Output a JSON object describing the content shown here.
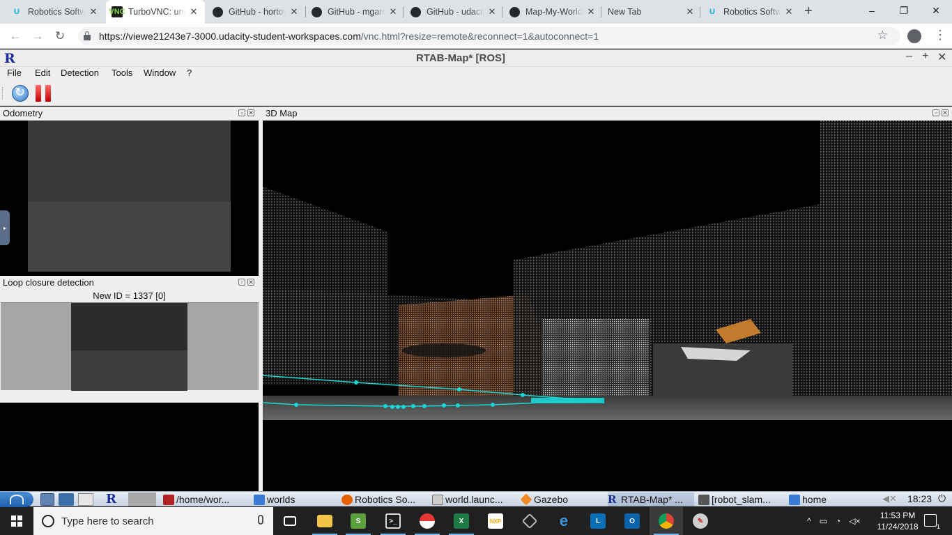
{
  "browser": {
    "tabs": [
      {
        "title": "Robotics Software",
        "icon": "udacity-icon"
      },
      {
        "title": "TurboVNC: unix",
        "icon": "turbovnc-icon",
        "active": true
      },
      {
        "title": "GitHub - hortovanyi",
        "icon": "github-icon"
      },
      {
        "title": "GitHub - mgarcia",
        "icon": "github-icon"
      },
      {
        "title": "GitHub - udacity",
        "icon": "github-icon"
      },
      {
        "title": "Map-My-World",
        "icon": "github-icon"
      },
      {
        "title": "New Tab",
        "icon": ""
      },
      {
        "title": "Robotics Software",
        "icon": "udacity-icon"
      }
    ],
    "new_tab": "+",
    "url_host": "https://viewe21243e7-3000.udacity-student-workspaces.com",
    "url_path": "/vnc.html?resize=remote&reconnect=1&autoconnect=1",
    "window_controls": {
      "minimize": "–",
      "restore": "❐",
      "close": "✕"
    }
  },
  "rtabmap": {
    "logo": "R",
    "title": "RTAB-Map* [ROS]",
    "window_buttons": [
      "–",
      "+",
      "✕"
    ],
    "menus": [
      "File",
      "Edit",
      "Detection",
      "Tools",
      "Window",
      "?"
    ],
    "odometry_label": "Odometry",
    "map_label": "3D Map",
    "loop_label": "Loop closure detection",
    "new_id": "New ID = 1337 [0]",
    "dock_float": "▫",
    "dock_close": "✕",
    "trajectory_color": "#19d6d6"
  },
  "vnc_panel": {
    "tasks": [
      {
        "label": "/home/wor...",
        "color": "#b22222"
      },
      {
        "label": "worlds",
        "color": "#3a7bd5"
      },
      {
        "label": "Robotics So...",
        "color": "#e66000"
      },
      {
        "label": "world.launc...",
        "color": "#cccccc"
      },
      {
        "label": "Gazebo",
        "color": "#f08a24"
      },
      {
        "label": "RTAB-Map* ...",
        "color": "#1b2f9a"
      },
      {
        "label": "[robot_slam...",
        "color": "#555555"
      },
      {
        "label": "home",
        "color": "#3a7bd5"
      }
    ],
    "clock": "18:23"
  },
  "windows": {
    "search_placeholder": "Type here to search",
    "time": "11:53 PM",
    "date": "11/24/2018",
    "apps": [
      "task-view",
      "file-explorer",
      "sublime-text",
      "terminal-app",
      "pokeball-app",
      "excel",
      "nxp-app",
      "3d-viewer",
      "edge",
      "lync",
      "outlook",
      "chrome",
      "paint-app"
    ]
  }
}
